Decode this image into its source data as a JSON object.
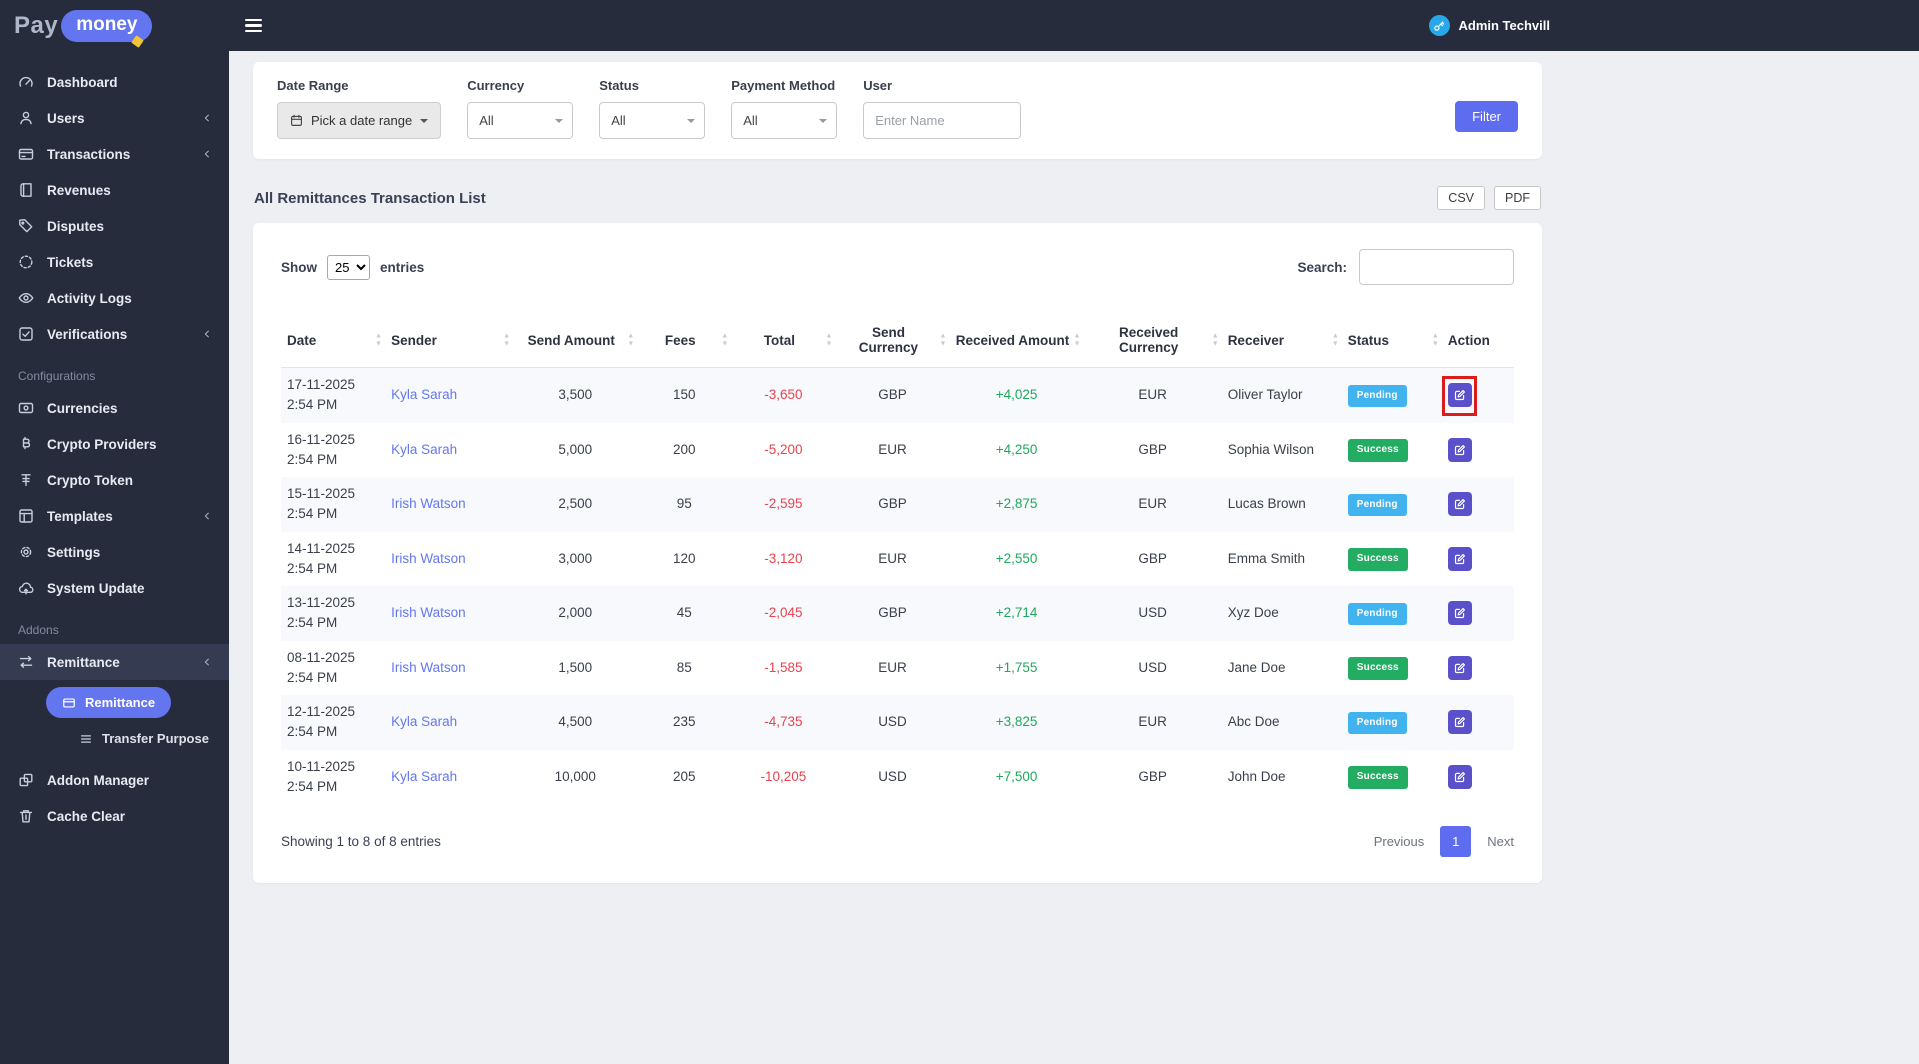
{
  "colors": {
    "accent": "#5e6cf0",
    "sidebar_bg": "#262c3c",
    "pending_badge": "#41b3ef",
    "success_badge": "#23ad62",
    "negative_amount": "#e8434e",
    "positive_amount": "#1fa95c",
    "action_button": "#5a50c9",
    "highlight_box": "#dd1c1c",
    "avatar_bg": "#2aa7e9"
  },
  "brand": {
    "part1": "Pay",
    "part2": "money"
  },
  "topbar": {
    "admin_label": "Admin Techvill"
  },
  "sidebar": {
    "sections": [
      {
        "header": "",
        "items": [
          {
            "label": "Dashboard",
            "icon": "dashboard-icon"
          },
          {
            "label": "Users",
            "icon": "users-icon",
            "chevron": true
          },
          {
            "label": "Transactions",
            "icon": "transactions-icon",
            "chevron": true
          },
          {
            "label": "Revenues",
            "icon": "revenues-icon"
          },
          {
            "label": "Disputes",
            "icon": "disputes-icon"
          },
          {
            "label": "Tickets",
            "icon": "tickets-icon"
          },
          {
            "label": "Activity Logs",
            "icon": "activity-logs-icon"
          },
          {
            "label": "Verifications",
            "icon": "verifications-icon",
            "chevron": true
          }
        ]
      },
      {
        "header": "Configurations",
        "items": [
          {
            "label": "Currencies",
            "icon": "currencies-icon"
          },
          {
            "label": "Crypto Providers",
            "icon": "crypto-providers-icon"
          },
          {
            "label": "Crypto Token",
            "icon": "crypto-token-icon"
          },
          {
            "label": "Templates",
            "icon": "templates-icon",
            "chevron": true
          },
          {
            "label": "Settings",
            "icon": "settings-icon"
          },
          {
            "label": "System Update",
            "icon": "system-update-icon"
          }
        ]
      },
      {
        "header": "Addons",
        "items": [
          {
            "label": "Remittance",
            "icon": "remittance-icon",
            "chevron": true,
            "active": true,
            "sub": [
              {
                "label": "Remittance",
                "icon": "wallet-icon",
                "active": true
              },
              {
                "label": "Transfer Purpose",
                "icon": "list-icon"
              }
            ]
          },
          {
            "label": "Addon Manager",
            "icon": "addon-manager-icon"
          },
          {
            "label": "Cache Clear",
            "icon": "cache-clear-icon"
          }
        ]
      }
    ]
  },
  "filters": {
    "date_range": {
      "label": "Date Range",
      "value": "Pick a date range"
    },
    "currency": {
      "label": "Currency",
      "value": "All"
    },
    "status": {
      "label": "Status",
      "value": "All"
    },
    "payment_method": {
      "label": "Payment Method",
      "value": "All"
    },
    "user": {
      "label": "User",
      "placeholder": "Enter Name"
    },
    "filter_button": "Filter"
  },
  "page": {
    "title": "All Remittances Transaction List",
    "export_csv": "CSV",
    "export_pdf": "PDF"
  },
  "table_controls": {
    "show_label": "Show",
    "page_size": "25",
    "entries_label": "entries",
    "search_label": "Search:"
  },
  "table": {
    "columns": [
      "Date",
      "Sender",
      "Send Amount",
      "Fees",
      "Total",
      "Send Currency",
      "Received Amount",
      "Received Currency",
      "Receiver",
      "Status",
      "Action"
    ],
    "rows": [
      {
        "date": "17-11-2025",
        "time": "2:54 PM",
        "sender": "Kyla Sarah",
        "send_amount": "3,500",
        "fees": "150",
        "total": "-3,650",
        "send_currency": "GBP",
        "received_amount": "+4,025",
        "received_currency": "EUR",
        "receiver": "Oliver Taylor",
        "status": "Pending",
        "highlighted": true
      },
      {
        "date": "16-11-2025",
        "time": "2:54 PM",
        "sender": "Kyla Sarah",
        "send_amount": "5,000",
        "fees": "200",
        "total": "-5,200",
        "send_currency": "EUR",
        "received_amount": "+4,250",
        "received_currency": "GBP",
        "receiver": "Sophia Wilson",
        "status": "Success"
      },
      {
        "date": "15-11-2025",
        "time": "2:54 PM",
        "sender": "Irish Watson",
        "send_amount": "2,500",
        "fees": "95",
        "total": "-2,595",
        "send_currency": "GBP",
        "received_amount": "+2,875",
        "received_currency": "EUR",
        "receiver": "Lucas Brown",
        "status": "Pending"
      },
      {
        "date": "14-11-2025",
        "time": "2:54 PM",
        "sender": "Irish Watson",
        "send_amount": "3,000",
        "fees": "120",
        "total": "-3,120",
        "send_currency": "EUR",
        "received_amount": "+2,550",
        "received_currency": "GBP",
        "receiver": "Emma Smith",
        "status": "Success"
      },
      {
        "date": "13-11-2025",
        "time": "2:54 PM",
        "sender": "Irish Watson",
        "send_amount": "2,000",
        "fees": "45",
        "total": "-2,045",
        "send_currency": "GBP",
        "received_amount": "+2,714",
        "received_currency": "USD",
        "receiver": "Xyz Doe",
        "status": "Pending"
      },
      {
        "date": "08-11-2025",
        "time": "2:54 PM",
        "sender": "Irish Watson",
        "send_amount": "1,500",
        "fees": "85",
        "total": "-1,585",
        "send_currency": "EUR",
        "received_amount": "+1,755",
        "received_currency": "USD",
        "receiver": "Jane Doe",
        "status": "Success"
      },
      {
        "date": "12-11-2025",
        "time": "2:54 PM",
        "sender": "Kyla Sarah",
        "send_amount": "4,500",
        "fees": "235",
        "total": "-4,735",
        "send_currency": "USD",
        "received_amount": "+3,825",
        "received_currency": "EUR",
        "receiver": "Abc Doe",
        "status": "Pending"
      },
      {
        "date": "10-11-2025",
        "time": "2:54 PM",
        "sender": "Kyla Sarah",
        "send_amount": "10,000",
        "fees": "205",
        "total": "-10,205",
        "send_currency": "USD",
        "received_amount": "+7,500",
        "received_currency": "GBP",
        "receiver": "John Doe",
        "status": "Success"
      }
    ]
  },
  "table_footer": {
    "info": "Showing 1 to 8 of 8 entries",
    "previous": "Previous",
    "page": "1",
    "next": "Next"
  }
}
